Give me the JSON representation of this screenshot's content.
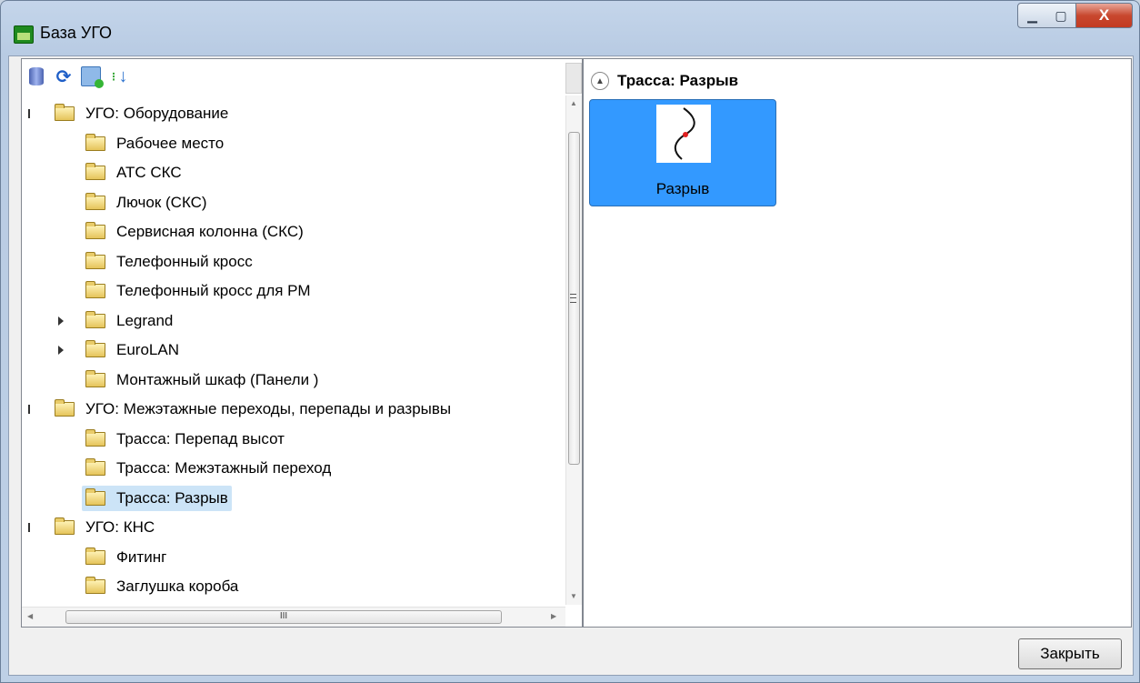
{
  "window": {
    "title": "База УГО",
    "minimize_symbol": "▁",
    "maximize_symbol": "▢",
    "close_symbol": "X"
  },
  "toolbar": {
    "icons": [
      "database-icon",
      "refresh-icon",
      "grid-settings-icon",
      "sort-icon"
    ]
  },
  "tree": {
    "items": [
      {
        "label": "УГО: Оборудование",
        "level": 0,
        "state": "expanded"
      },
      {
        "label": "Рабочее место",
        "level": 1
      },
      {
        "label": "АТС СКС",
        "level": 1
      },
      {
        "label": "Лючок (СКС)",
        "level": 1
      },
      {
        "label": "Сервисная колонна (СКС)",
        "level": 1
      },
      {
        "label": "Телефонный кросс",
        "level": 1
      },
      {
        "label": "Телефонный кросс для РМ",
        "level": 1
      },
      {
        "label": "Legrand",
        "level": 1,
        "state": "collapsed"
      },
      {
        "label": "EuroLAN",
        "level": 1,
        "state": "collapsed"
      },
      {
        "label": "Монтажный шкаф (Панели )",
        "level": 1
      },
      {
        "label": "УГО: Межэтажные переходы, перепады и разрывы",
        "level": 0,
        "state": "expanded"
      },
      {
        "label": "Трасса: Перепад высот",
        "level": 1
      },
      {
        "label": "Трасса: Межэтажный переход",
        "level": 1
      },
      {
        "label": "Трасса: Разрыв",
        "level": 1,
        "selected": true
      },
      {
        "label": "УГО: КНС",
        "level": 0,
        "state": "expanded"
      },
      {
        "label": "Фитинг",
        "level": 1
      },
      {
        "label": "Заглушка короба",
        "level": 1
      }
    ]
  },
  "scrollbar": {
    "h_thumb_grip": "III"
  },
  "preview": {
    "group_title": "Трасса: Разрыв",
    "items": [
      {
        "label": "Разрыв",
        "selected": true
      }
    ]
  },
  "footer": {
    "close_label": "Закрыть"
  },
  "colors": {
    "selection": "#3399ff",
    "tree_selection": "#cce4f7",
    "close_button_red": "#c8482f"
  }
}
